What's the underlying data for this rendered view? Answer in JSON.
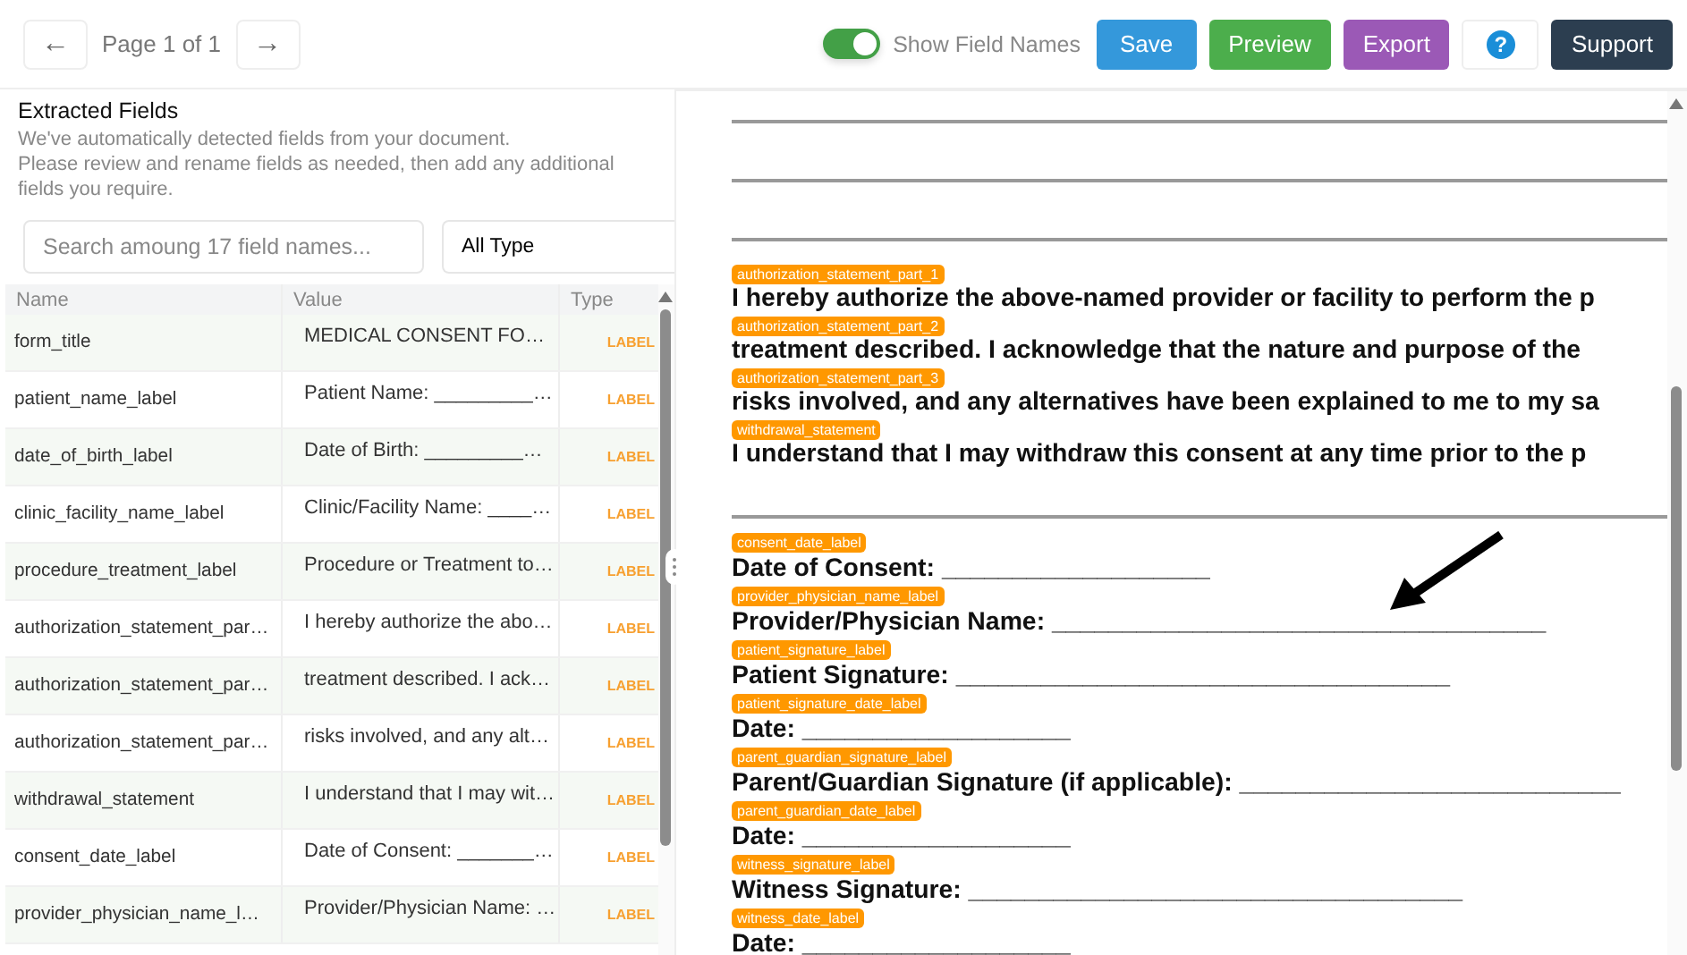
{
  "pager": {
    "prev": "←",
    "label": "Page 1 of 1",
    "next": "→"
  },
  "toolbar": {
    "show_field_names": {
      "label": "Show Field Names",
      "on": true
    },
    "buttons": [
      {
        "label": "Save",
        "kind": "save"
      },
      {
        "label": "Preview",
        "kind": "preview"
      },
      {
        "label": "Export",
        "kind": "export"
      },
      {
        "label": "?",
        "kind": "help"
      },
      {
        "label": "Support",
        "kind": "support"
      }
    ]
  },
  "panel": {
    "title": "Extracted Fields",
    "description": [
      "We've automatically detected fields from your document.",
      "Please review and rename fields as needed, then add any additional fields you require."
    ],
    "search": {
      "placeholder": "Search amoung 17 field names..."
    },
    "type_filter": "All Type"
  },
  "table": {
    "columns": [
      "Name",
      "Value",
      "Type"
    ],
    "rows": [
      {
        "name": "form_title",
        "value": "MEDICAL CONSENT FO…",
        "type": "LABEL"
      },
      {
        "name": "patient_name_label",
        "value": "Patient Name: _________…",
        "type": "LABEL"
      },
      {
        "name": "date_of_birth_label",
        "value": "Date of Birth: _________…",
        "type": "LABEL"
      },
      {
        "name": "clinic_facility_name_label",
        "value": "Clinic/Facility Name: ____…",
        "type": "LABEL"
      },
      {
        "name": "procedure_treatment_label",
        "value": "Procedure or Treatment to…",
        "type": "LABEL"
      },
      {
        "name": "authorization_statement_par…",
        "value": "I hereby authorize the abo…",
        "type": "LABEL"
      },
      {
        "name": "authorization_statement_par…",
        "value": "treatment described. I ack…",
        "type": "LABEL"
      },
      {
        "name": "authorization_statement_par…",
        "value": "risks involved, and any alt…",
        "type": "LABEL"
      },
      {
        "name": "withdrawal_statement",
        "value": "I understand that I may wit…",
        "type": "LABEL"
      },
      {
        "name": "consent_date_label",
        "value": "Date of Consent: _______…",
        "type": "LABEL"
      },
      {
        "name": "provider_physician_name_l…",
        "value": "Provider/Physician Name: …",
        "type": "LABEL"
      }
    ]
  },
  "document": {
    "items": [
      {
        "kind": "rule"
      },
      {
        "kind": "rule"
      },
      {
        "kind": "rule"
      },
      {
        "kind": "text",
        "tag": "authorization_statement_part_1",
        "text": "I hereby authorize the above-named provider or facility to perform the p"
      },
      {
        "kind": "text",
        "tag": "authorization_statement_part_2",
        "text": "treatment described. I acknowledge that the nature and purpose of the"
      },
      {
        "kind": "text",
        "tag": "authorization_statement_part_3",
        "text": "risks involved, and any alternatives have been explained to me to my sa"
      },
      {
        "kind": "text",
        "tag": "withdrawal_statement",
        "text": "I understand that I may withdraw this consent at any time prior to the p"
      },
      {
        "kind": "rule"
      },
      {
        "kind": "text",
        "tag": "consent_date_label",
        "text": "Date of Consent: ___________________"
      },
      {
        "kind": "text",
        "tag": "provider_physician_name_label",
        "text": "Provider/Physician Name: ___________________________________"
      },
      {
        "kind": "text",
        "tag": "patient_signature_label",
        "text": "Patient Signature: ___________________________________"
      },
      {
        "kind": "text",
        "tag": "patient_signature_date_label",
        "text": "Date: ___________________"
      },
      {
        "kind": "text",
        "tag": "parent_guardian_signature_label",
        "text": "Parent/Guardian Signature (if applicable): ___________________________"
      },
      {
        "kind": "text",
        "tag": "parent_guardian_date_label",
        "text": "Date: ___________________"
      },
      {
        "kind": "text",
        "tag": "witness_signature_label",
        "text": "Witness Signature: ___________________________________"
      },
      {
        "kind": "text",
        "tag": "witness_date_label",
        "text": "Date: ___________________"
      }
    ]
  }
}
